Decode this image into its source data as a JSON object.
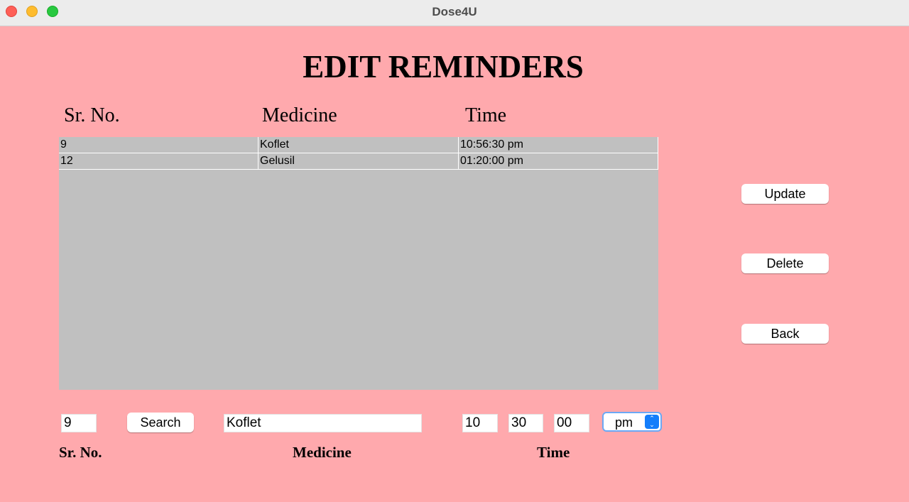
{
  "window": {
    "title": "Dose4U"
  },
  "page": {
    "title": "EDIT REMINDERS"
  },
  "table": {
    "headers": [
      "Sr. No.",
      "Medicine",
      "Time"
    ],
    "rows": [
      [
        "9",
        "Koflet",
        "10:56:30 pm"
      ],
      [
        "12",
        "Gelusil",
        "01:20:00 pm"
      ]
    ]
  },
  "actions": {
    "update": "Update",
    "delete": "Delete",
    "back": "Back"
  },
  "form": {
    "sr_no": "9",
    "search_label": "Search",
    "medicine": "Koflet",
    "hour": "10",
    "minute": "30",
    "second": "00",
    "ampm": "pm",
    "labels": {
      "sr_no": "Sr. No.",
      "medicine": "Medicine",
      "time": "Time"
    }
  }
}
